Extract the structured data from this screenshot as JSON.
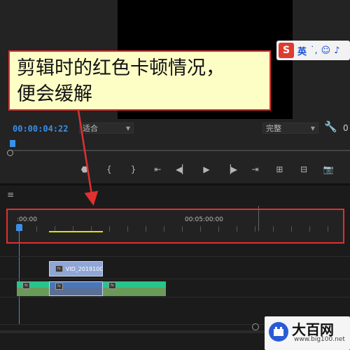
{
  "monitor": {
    "timecode": "00:00:04:22",
    "zoom_label": "适合",
    "quality_label": "完整",
    "counter": "0"
  },
  "ime": {
    "logo": "S",
    "lang": "英",
    "icons": [
      "punctuation-icon",
      "emoji-icon",
      "microphone-icon"
    ]
  },
  "transport": {
    "icons": [
      "marker-icon",
      "mark-in-icon",
      "mark-out-icon",
      "go-to-in-icon",
      "step-back-icon",
      "play-icon",
      "step-forward-icon",
      "go-to-out-icon",
      "lift-icon",
      "extract-icon",
      "export-frame-icon"
    ]
  },
  "timeline": {
    "menu_icon": "≡",
    "ruler_start": ":00:00",
    "ruler_mid": "00:05:00:00",
    "video_clip_label": "VID_2019100",
    "fx_badge": "fx"
  },
  "annotation": {
    "callout_line1": "剪辑时的红色卡顿情况，",
    "callout_line2": "便会缓解"
  },
  "watermark": {
    "title": "大百网",
    "url": "www.big100.net"
  },
  "colors": {
    "accent_blue": "#3b8fe6",
    "render_yellow": "#e5e000",
    "highlight_red": "#e03030",
    "callout_bg": "#fdfdc6",
    "audio_green": "#28c48a",
    "video_clip": "#8fa6d6"
  }
}
